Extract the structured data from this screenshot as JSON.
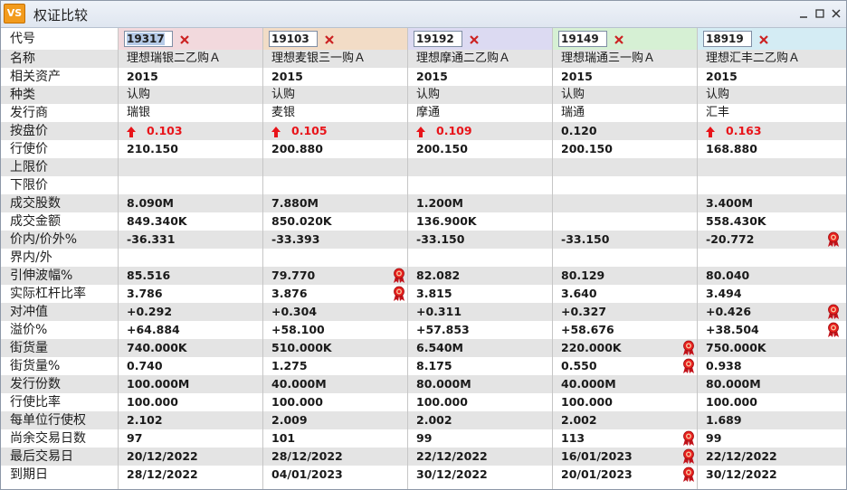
{
  "window": {
    "title": "权证比较",
    "app_icon": "VS"
  },
  "colors": {
    "col_headers": [
      "#f2d9dd",
      "#f2dcc6",
      "#dcdaf2",
      "#d6f0d4",
      "#d4ecf4"
    ],
    "row_alt": "#e4e4e4",
    "price_up": "#e8141a",
    "remove": "#cc2222"
  },
  "header_label": "代号",
  "codes": [
    "19317",
    "19103",
    "19192",
    "19149",
    "18919"
  ],
  "rows": [
    {
      "label": "名称",
      "bold": false,
      "values": [
        "理想瑞银二乙购Ａ",
        "理想麦银三一购Ａ",
        "理想摩通二乙购Ａ",
        "理想瑞通三一购Ａ",
        "理想汇丰二乙购Ａ"
      ]
    },
    {
      "label": "相关资产",
      "bold": true,
      "values": [
        "2015",
        "2015",
        "2015",
        "2015",
        "2015"
      ]
    },
    {
      "label": "种类",
      "bold": false,
      "values": [
        "认购",
        "认购",
        "认购",
        "认购",
        "认购"
      ]
    },
    {
      "label": "发行商",
      "bold": false,
      "values": [
        "瑞银",
        "麦银",
        "摩通",
        "瑞通",
        "汇丰"
      ]
    },
    {
      "label": "按盘价",
      "bold": true,
      "values": [
        "0.103",
        "0.105",
        "0.109",
        "0.120",
        "0.163"
      ],
      "up": [
        true,
        true,
        true,
        false,
        true
      ]
    },
    {
      "label": "行使价",
      "bold": true,
      "values": [
        "210.150",
        "200.880",
        "200.150",
        "200.150",
        "168.880"
      ]
    },
    {
      "label": "上限价",
      "bold": true,
      "values": [
        "",
        "",
        "",
        "",
        ""
      ]
    },
    {
      "label": "下限价",
      "bold": true,
      "values": [
        "",
        "",
        "",
        "",
        ""
      ]
    },
    {
      "label": "成交股数",
      "bold": true,
      "values": [
        "8.090M",
        "7.880M",
        "1.200M",
        "",
        "3.400M"
      ]
    },
    {
      "label": "成交金额",
      "bold": true,
      "values": [
        "849.340K",
        "850.020K",
        "136.900K",
        "",
        "558.430K"
      ]
    },
    {
      "label": "价内/价外%",
      "bold": true,
      "values": [
        "-36.331",
        "-33.393",
        "-33.150",
        "-33.150",
        "-20.772"
      ],
      "badges": [
        false,
        false,
        false,
        false,
        true
      ]
    },
    {
      "label": "界内/外",
      "bold": true,
      "values": [
        "",
        "",
        "",
        "",
        ""
      ]
    },
    {
      "label": "引伸波幅%",
      "bold": true,
      "values": [
        "85.516",
        "79.770",
        "82.082",
        "80.129",
        "80.040"
      ],
      "badges": [
        false,
        true,
        false,
        false,
        false
      ]
    },
    {
      "label": "实际杠杆比率",
      "bold": true,
      "values": [
        "3.786",
        "3.876",
        "3.815",
        "3.640",
        "3.494"
      ],
      "badges": [
        false,
        true,
        false,
        false,
        false
      ]
    },
    {
      "label": "对冲值",
      "bold": true,
      "values": [
        "+0.292",
        "+0.304",
        "+0.311",
        "+0.327",
        "+0.426"
      ],
      "badges": [
        false,
        false,
        false,
        false,
        true
      ]
    },
    {
      "label": "溢价%",
      "bold": true,
      "values": [
        "+64.884",
        "+58.100",
        "+57.853",
        "+58.676",
        "+38.504"
      ],
      "badges": [
        false,
        false,
        false,
        false,
        true
      ]
    },
    {
      "label": "街货量",
      "bold": true,
      "values": [
        "740.000K",
        "510.000K",
        "6.540M",
        "220.000K",
        "750.000K"
      ],
      "badges": [
        false,
        false,
        false,
        true,
        false
      ]
    },
    {
      "label": "街货量%",
      "bold": true,
      "values": [
        "0.740",
        "1.275",
        "8.175",
        "0.550",
        "0.938"
      ],
      "badges": [
        false,
        false,
        false,
        true,
        false
      ]
    },
    {
      "label": "发行份数",
      "bold": true,
      "values": [
        "100.000M",
        "40.000M",
        "80.000M",
        "40.000M",
        "80.000M"
      ]
    },
    {
      "label": "行使比率",
      "bold": true,
      "values": [
        "100.000",
        "100.000",
        "100.000",
        "100.000",
        "100.000"
      ]
    },
    {
      "label": "每单位行使权",
      "bold": true,
      "values": [
        "2.102",
        "2.009",
        "2.002",
        "2.002",
        "1.689"
      ]
    },
    {
      "label": "尚余交易日数",
      "bold": true,
      "values": [
        "97",
        "101",
        "99",
        "113",
        "99"
      ],
      "badges": [
        false,
        false,
        false,
        true,
        false
      ]
    },
    {
      "label": "最后交易日",
      "bold": true,
      "values": [
        "20/12/2022",
        "28/12/2022",
        "22/12/2022",
        "16/01/2023",
        "22/12/2022"
      ],
      "badges": [
        false,
        false,
        false,
        true,
        false
      ]
    },
    {
      "label": "到期日",
      "bold": true,
      "values": [
        "28/12/2022",
        "04/01/2023",
        "30/12/2022",
        "20/01/2023",
        "30/12/2022"
      ],
      "badges": [
        false,
        false,
        false,
        true,
        false
      ]
    }
  ]
}
